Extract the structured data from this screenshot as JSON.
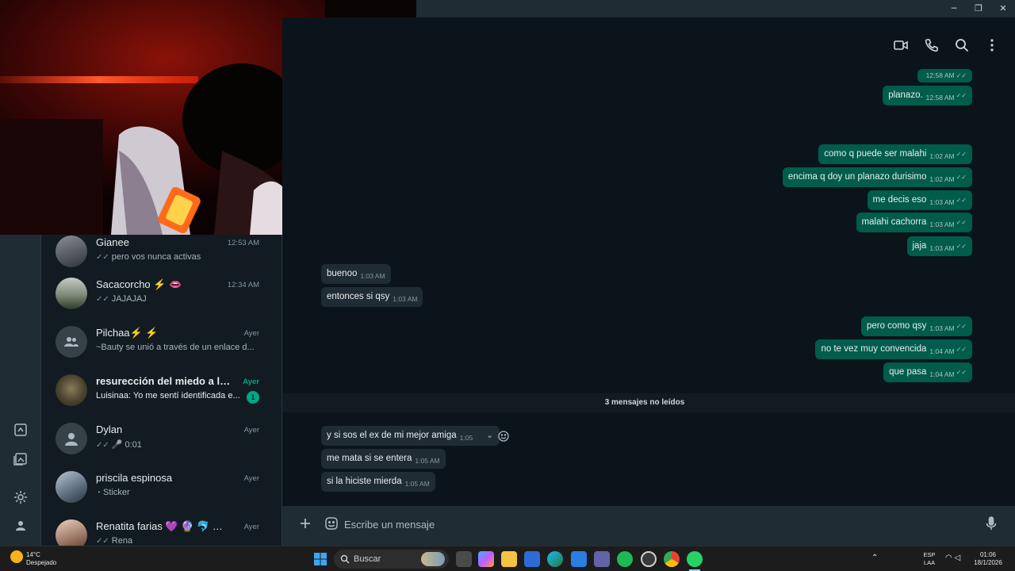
{
  "window": {
    "minimize_glyph": "─",
    "maximize_glyph": "❐",
    "close_glyph": "✕"
  },
  "rail": {
    "icons": [
      "status-icon",
      "media-icon",
      "settings-icon",
      "profile-icon"
    ]
  },
  "chats": [
    {
      "name": "Gianee",
      "time": "12:53 AM",
      "preview": "pero vos nunca activas",
      "ticks": "✓✓",
      "avatar": "photo"
    },
    {
      "name": "Sacacorcho ⚡ 👄",
      "time": "12:34 AM",
      "preview": "JAJAJAJ",
      "ticks": "✓✓",
      "avatar": "photo"
    },
    {
      "name": "Pilchaa⚡ ⚡",
      "time": "Ayer",
      "preview": "~Bauty se unió a través de un enlace d...",
      "ticks": "",
      "avatar": "group"
    },
    {
      "name": "resurección del miedo a las p...",
      "time": "Ayer",
      "preview": "Luisinaa: Yo me sentí identificada e...",
      "ticks": "",
      "avatar": "photo",
      "unread": "1"
    },
    {
      "name": "Dylan",
      "time": "Ayer",
      "preview": "🎤 0:01",
      "ticks": "✓✓",
      "avatar": "person"
    },
    {
      "name": "priscila espinosa",
      "time": "Ayer",
      "preview": "Sticker",
      "ticks": "",
      "avatar": "photo"
    },
    {
      "name": "Renatita farias 💜 🔮 🐬 🦄 ...",
      "time": "Ayer",
      "preview": "Rena",
      "ticks": "✓✓",
      "avatar": "photo"
    }
  ],
  "messages": [
    {
      "dir": "out",
      "text": "",
      "time": "12:58 AM"
    },
    {
      "dir": "out",
      "text": "planazo.",
      "time": "12:58 AM"
    },
    {
      "dir": "out",
      "text": "como q puede ser malahi",
      "time": "1:02 AM"
    },
    {
      "dir": "out",
      "text": "encima q doy un planazo durisimo",
      "time": "1:02 AM"
    },
    {
      "dir": "out",
      "text": "me decis eso",
      "time": "1:03 AM"
    },
    {
      "dir": "out",
      "text": "malahi cachorra",
      "time": "1:03 AM"
    },
    {
      "dir": "out",
      "text": "jaja",
      "time": "1:03 AM"
    },
    {
      "dir": "in",
      "text": "buenoo",
      "time": "1:03 AM"
    },
    {
      "dir": "in",
      "text": "entonces si qsy",
      "time": "1:03 AM"
    },
    {
      "dir": "out",
      "text": "pero como qsy",
      "time": "1:03 AM"
    },
    {
      "dir": "out",
      "text": "no te vez muy convencida",
      "time": "1:04 AM"
    },
    {
      "dir": "out",
      "text": "que pasa",
      "time": "1:04 AM"
    },
    {
      "dir": "in",
      "text": "y si sos el ex de mi mejor amiga",
      "time": "1:05"
    },
    {
      "dir": "in",
      "text": "me mata si se entera",
      "time": "1:05 AM"
    },
    {
      "dir": "in",
      "text": "si la hiciste mierda",
      "time": "1:05 AM"
    }
  ],
  "unread_divider": "3 mensajes no leídos",
  "composer": {
    "placeholder": "Escribe un mensaje"
  },
  "header_icons": [
    "video-call-icon",
    "voice-call-icon",
    "search-icon",
    "menu-icon"
  ],
  "taskbar": {
    "weather_temp": "14°C",
    "weather_desc": "Despejado",
    "search_label": "Buscar",
    "lang_top": "ESP",
    "lang_bottom": "LAA",
    "clock_time": "01:06",
    "clock_date": "18/1/2026"
  },
  "colors": {
    "outgoing_bubble": "#005c4b",
    "incoming_bubble": "#202c33",
    "accent": "#00a884",
    "background": "#0b141a"
  }
}
